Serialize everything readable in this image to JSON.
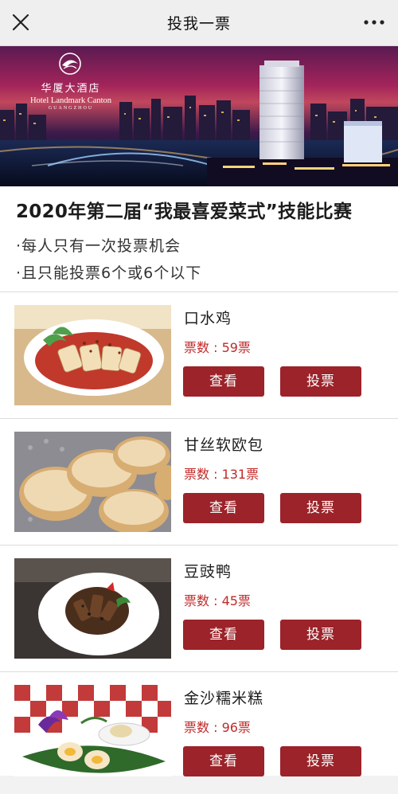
{
  "navbar": {
    "title": "投我一票",
    "close_icon": "close-icon",
    "more_icon": "more-dots-icon"
  },
  "banner": {
    "hotel_name_cn": "华厦大酒店",
    "hotel_name_en": "Hotel Landmark Canton",
    "hotel_city": "GUANGZHOU"
  },
  "contest": {
    "title": "2020年第二届“我最喜爱菜式”技能比赛",
    "rule1": "·每人只有一次投票机会",
    "rule2": "·且只能投票6个或6个以下"
  },
  "labels": {
    "view": "查看",
    "vote": "投票"
  },
  "dishes": [
    {
      "name": "口水鸡",
      "votes": "票数 : 59票"
    },
    {
      "name": "甘丝软欧包",
      "votes": "票数 : 131票"
    },
    {
      "name": "豆豉鸭",
      "votes": "票数 : 45票"
    },
    {
      "name": "金沙糯米糕",
      "votes": "票数 : 96票"
    }
  ],
  "colors": {
    "button": "#9b2329",
    "vote_count": "#c12a2a"
  }
}
